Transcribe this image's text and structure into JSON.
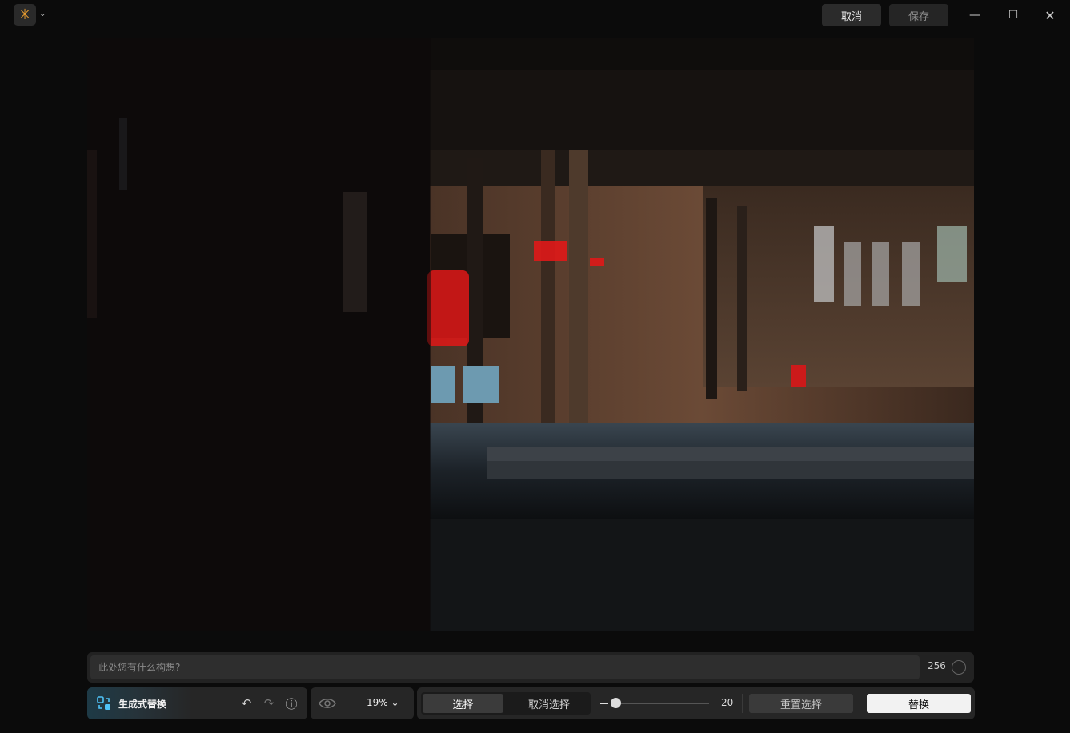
{
  "window": {
    "app_icon": "sparkle-icon",
    "cancel_label": "取消",
    "save_label": "保存",
    "minimize_icon": "minimize-icon",
    "maximize_icon": "maximize-icon",
    "close_icon": "close-icon"
  },
  "prompt": {
    "placeholder": "此处您有什么构想?",
    "char_limit": "256"
  },
  "toolbar": {
    "mode_label": "生成式替换",
    "zoom": "19%",
    "select_label": "选择",
    "deselect_label": "取消选择",
    "brush_size": "20",
    "reset_selection_label": "重置选择",
    "replace_label": "替换"
  },
  "colors": {
    "accent": "#f7a531",
    "mask": "#e01818",
    "primary_button": "#f2f2f2"
  }
}
